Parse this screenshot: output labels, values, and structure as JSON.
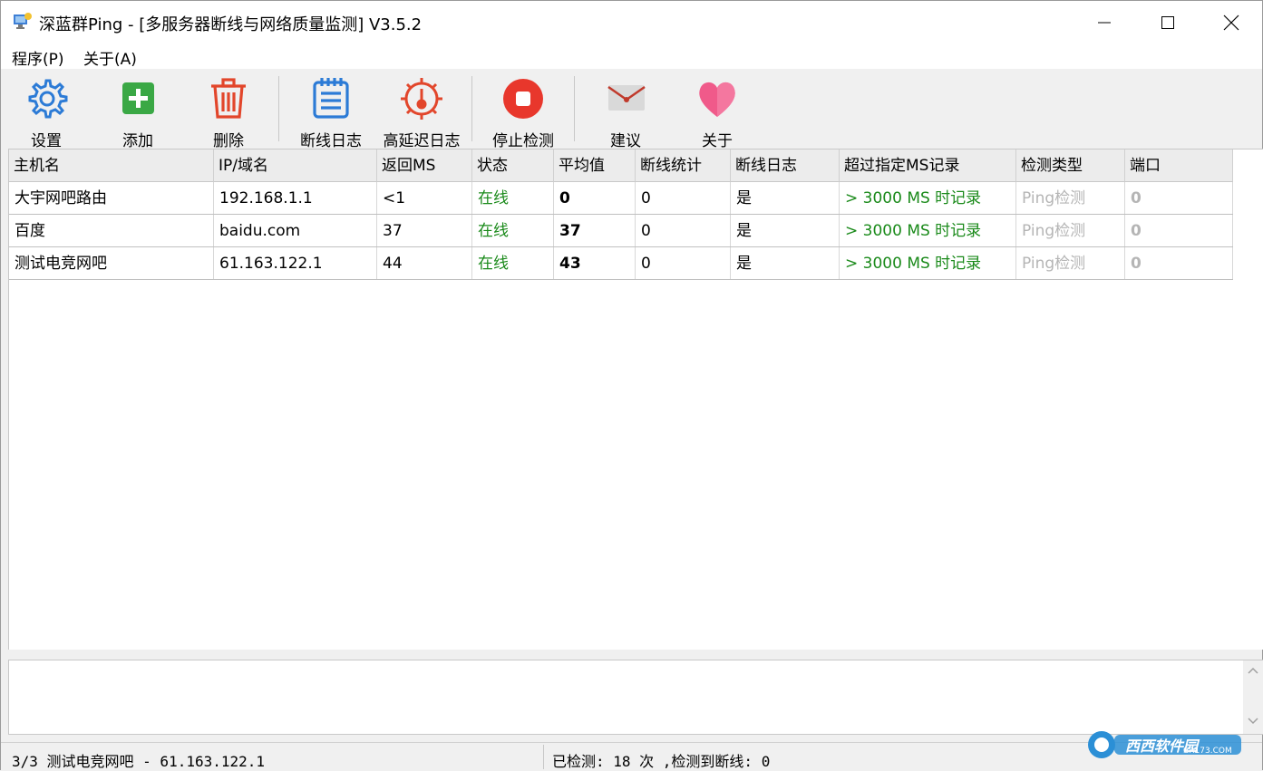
{
  "window": {
    "title": "深蓝群Ping - [多服务器断线与网络质量监测] V3.5.2"
  },
  "menu": [
    "程序(P)",
    "关于(A)"
  ],
  "toolbar": {
    "settings": "设置",
    "add": "添加",
    "delete": "删除",
    "disconnect_log": "断线日志",
    "latency_log": "高延迟日志",
    "stop": "停止检测",
    "suggest": "建议",
    "about": "关于"
  },
  "columns": [
    "主机名",
    "IP/域名",
    "返回MS",
    "状态",
    "平均值",
    "断线统计",
    "断线日志",
    "超过指定MS记录",
    "检测类型",
    "端口"
  ],
  "rows": [
    {
      "host": "大宇网吧路由",
      "ip": "192.168.1.1",
      "ms": "<1",
      "status": "在线",
      "avg": "0",
      "drops": "0",
      "log": "是",
      "over": "> 3000 MS 时记录",
      "type": "Ping检测",
      "port": "0"
    },
    {
      "host": "百度",
      "ip": "baidu.com",
      "ms": "37",
      "status": "在线",
      "avg": "37",
      "drops": "0",
      "log": "是",
      "over": "> 3000 MS 时记录",
      "type": "Ping检测",
      "port": "0"
    },
    {
      "host": "测试电竞网吧",
      "ip": "61.163.122.1",
      "ms": "44",
      "status": "在线",
      "avg": "43",
      "drops": "0",
      "log": "是",
      "over": "> 3000 MS 时记录",
      "type": "Ping检测",
      "port": "0"
    }
  ],
  "status": {
    "left": "3/3 测试电竞网吧 - 61.163.122.1",
    "right": "已检测: 18 次 ,检测到断线: 0"
  },
  "watermark": {
    "brand": "西西软件园",
    "url": "CR173.COM"
  },
  "colors": {
    "online": "#1a8a1a",
    "disabled": "#b5b5b5",
    "settings_icon": "#2c7bd6",
    "add_icon": "#3aa845",
    "delete_icon": "#e2462b",
    "stop_icon": "#e8372c",
    "about_icon": "#f05a8a"
  }
}
